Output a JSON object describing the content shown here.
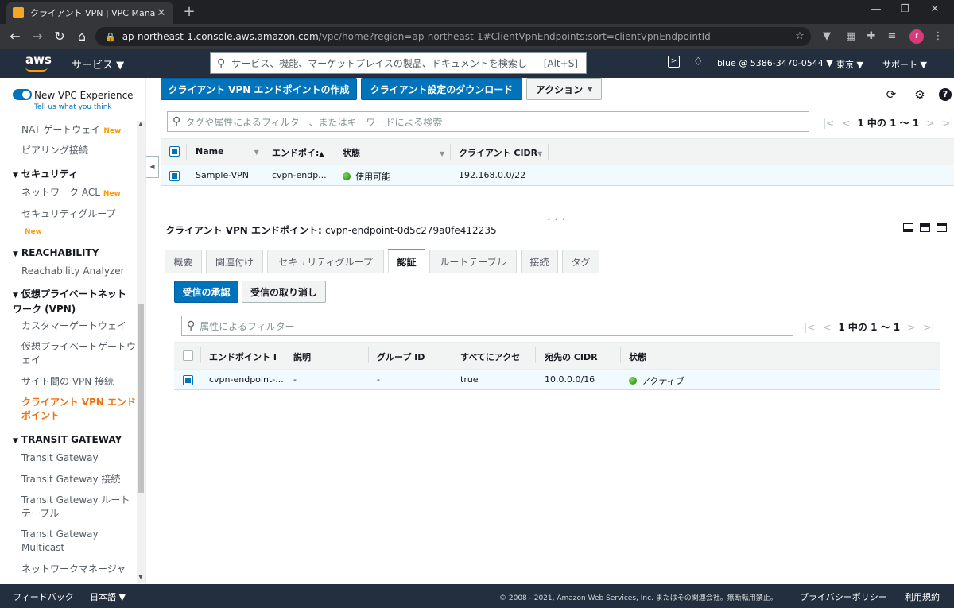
{
  "browser": {
    "tab_title": "クライアント VPN | VPC Managemen",
    "tab_close": "✕",
    "new_tab": "+",
    "url_host": "ap-northeast-1.console.aws.amazon.com",
    "url_path": "/vpc/home?region=ap-northeast-1#ClientVpnEndpoints:sort=clientVpnEndpointId",
    "profile_initial": "r"
  },
  "aws_nav": {
    "logo": "aws",
    "services": "サービス ▼",
    "search_placeholder": "サービス、機能、マーケットプレイスの製品、ドキュメントを検索し",
    "search_shortcut": "[Alt+S]",
    "account": "blue @ 5386-3470-0544 ▼",
    "region": "東京 ▼",
    "support": "サポート ▼"
  },
  "sidebar": {
    "new_vpc_label": "New VPC Experience",
    "tell_us": "Tell us what you think",
    "nat_gateway": "NAT ゲートウェイ",
    "peering": "ピアリング接続",
    "security_head": "セキュリティ",
    "network_acl": "ネットワーク ACL",
    "security_groups": "セキュリティグループ",
    "new_badge": "New",
    "reachability_head": "REACHABILITY",
    "reachability_analyzer": "Reachability Analyzer",
    "vpn_head": "仮想プライベートネットワーク (VPN)",
    "customer_gateway": "カスタマーゲートウェイ",
    "virtual_private_gateway": "仮想プライベートゲートウェイ",
    "site_to_site": "サイト間の VPN 接続",
    "client_vpn": "クライアント VPN エンドポイント",
    "transit_head": "TRANSIT GATEWAY",
    "transit_gateway": "Transit Gateway",
    "transit_attach": "Transit Gateway 接続",
    "transit_route": "Transit Gateway ルートテーブル",
    "transit_multicast": "Transit Gateway Multicast",
    "network_manager": "ネットワークマネージャ"
  },
  "toolbar": {
    "create": "クライアント VPN エンドポイントの作成",
    "download": "クライアント設定のダウンロード",
    "actions": "アクション"
  },
  "top_table": {
    "filter_placeholder": "タグや属性によるフィルター、またはキーワードによる検索",
    "pager": "1 中の 1 〜 1",
    "columns": [
      "Name",
      "エンドポイ:",
      "状態",
      "クライアント CIDR"
    ],
    "row": {
      "name": "Sample-VPN",
      "endpoint": "cvpn-endp...",
      "state": "使用可能",
      "cidr": "192.168.0.0/22"
    }
  },
  "detail": {
    "title_label": "クライアント VPN エンドポイント:",
    "title_value": "cvpn-endpoint-0d5c279a0fe412235",
    "tabs": [
      "概要",
      "関連付け",
      "セキュリティグループ",
      "認証",
      "ルートテーブル",
      "接続",
      "タグ"
    ],
    "authorize": "受信の承認",
    "revoke": "受信の取り消し",
    "filter_placeholder": "属性によるフィルター",
    "pager": "1 中の 1 〜 1",
    "columns": [
      "エンドポイント I",
      "説明",
      "グループ ID",
      "すべてにアクセ",
      "宛先の CIDR",
      "状態"
    ],
    "row": {
      "endpoint": "cvpn-endpoint-...",
      "desc": "-",
      "group": "-",
      "all": "true",
      "cidr": "10.0.0.0/16",
      "state": "アクティブ"
    }
  },
  "footer": {
    "feedback": "フィードバック",
    "language": "日本語 ▼",
    "copyright": "© 2008 - 2021, Amazon Web Services, Inc. またはその関連会社。無断転用禁止。",
    "privacy": "プライバシーポリシー",
    "terms": "利用規約"
  },
  "colors": {
    "primary": "#0073bb",
    "nav": "#232f3e",
    "active_orange": "#ec7211",
    "new_badge": "#ff9900",
    "status_green": "#1d8102"
  },
  "icons": [
    "refresh-icon",
    "gear-icon",
    "help-icon",
    "search-icon",
    "bell-icon",
    "cloudshell-icon"
  ]
}
